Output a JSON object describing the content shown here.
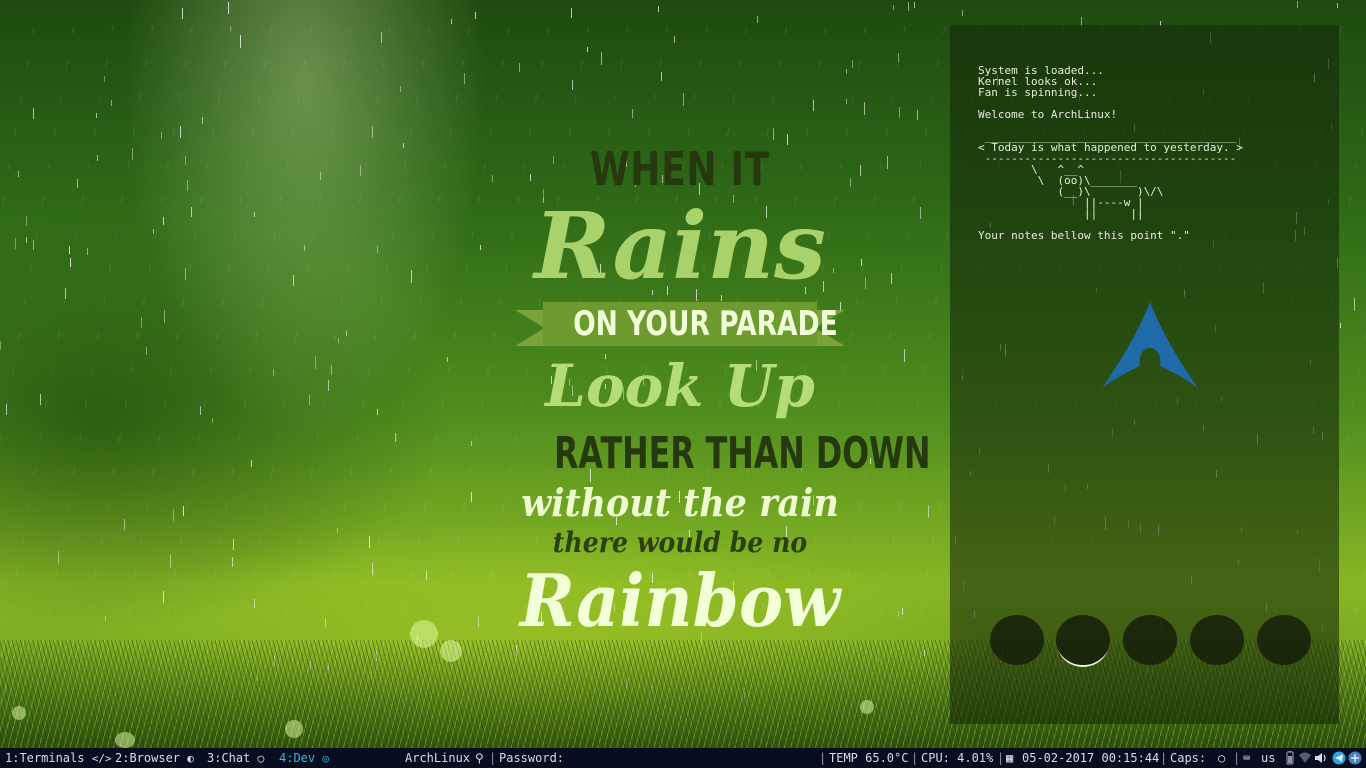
{
  "wallpaper": {
    "quote": {
      "line1": "WHEN IT",
      "line2": "Rains",
      "line3": "ON YOUR PARADE",
      "line4": "Look Up",
      "line5": "RATHER THAN DOWN",
      "line6": "without the rain",
      "line7": "there would be no",
      "line8": "Rainbow"
    }
  },
  "conky": {
    "lines": [
      "System is loaded...",
      "Kernel looks ok...",
      "Fan is spinning...",
      "",
      "Welcome to ArchLinux!",
      "",
      " ______________________________________",
      "< Today is what happened to yesterday. >",
      " --------------------------------------",
      "        \\   ^__^",
      "         \\  (oo)\\_______",
      "            (__)\\       )\\/\\",
      "                ||----w |",
      "                ||     ||",
      "",
      "Your notes bellow this point \".\""
    ],
    "logo": "arch-logo",
    "logo_color": "#1f6aa8",
    "dock_count": 5,
    "dock_active_index": 1
  },
  "taskbar": {
    "workspaces": [
      {
        "label": "1:Terminals",
        "icon": "code-icon",
        "glyph": "</>",
        "active": false
      },
      {
        "label": "2:Browser",
        "icon": "firefox-icon",
        "glyph": "◐",
        "active": false
      },
      {
        "label": "3:Chat",
        "icon": "chat-bubble-icon",
        "glyph": "◯",
        "active": false
      },
      {
        "label": "4:Dev",
        "icon": "github-icon",
        "glyph": "◎",
        "active": true
      }
    ],
    "host": "ArchLinux",
    "host_icon": "tux-icon",
    "password_label": "Password:",
    "temp": "TEMP 65.0°C",
    "cpu": "CPU: 4.01%",
    "calendar_icon": "calendar-icon",
    "datetime": "05-02-2017 00:15:44",
    "caps": "Caps:",
    "caps_icon": "circle-icon",
    "keyboard_icon": "keyboard-icon",
    "layout": "us",
    "accent_color": "#32b7d3",
    "bar_color": "#080d20"
  }
}
